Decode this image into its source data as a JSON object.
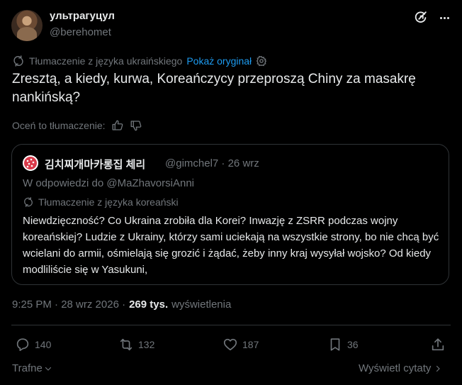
{
  "author": {
    "display_name": "ультрагуцул",
    "handle": "@berehomet"
  },
  "translation": {
    "label": "Tłumaczenie z języka ukraińskiego",
    "show_original": "Pokaż oryginał"
  },
  "tweet_text": "Zresztą, a kiedy, kurwa, Koreańczycy przeproszą Chiny za masakrę nankińską?",
  "rate_label": "Oceń to tłumaczenie:",
  "quote": {
    "display_name": "김치찌개마카롱집 체리",
    "handle_time": "@gimchel7 · 26 wrz",
    "reply_to": "W odpowiedzi do @MaZhavorsiAnni",
    "translation_label": "Tłumaczenie z języka koreański",
    "text": "Niewdzięczność? Co Ukraina zrobiła dla Korei? Inwazję z ZSRR podczas wojny koreańskiej? Ludzie z Ukrainy, którzy sami uciekają na wszystkie strony, bo nie chcą być wcielani do armii, ośmielają się grozić i żądać, żeby inny kraj wysyłał wojsko? Od kiedy modliliście się w Yasukuni,"
  },
  "meta": {
    "time_date": "9:25 PM · 28 wrz 2026 ·",
    "views_count": "269 tys.",
    "views_label": "wyświetlenia"
  },
  "actions": {
    "replies": "140",
    "reposts": "132",
    "likes": "187",
    "bookmarks": "36"
  },
  "footer": {
    "sort_label": "Trafne",
    "quotes_link": "Wyświetl cytaty"
  },
  "colors": {
    "background": "#000000",
    "text": "#e7e9ea",
    "muted": "#71767b",
    "accent": "#1d9bf0",
    "border": "#2f3336"
  }
}
